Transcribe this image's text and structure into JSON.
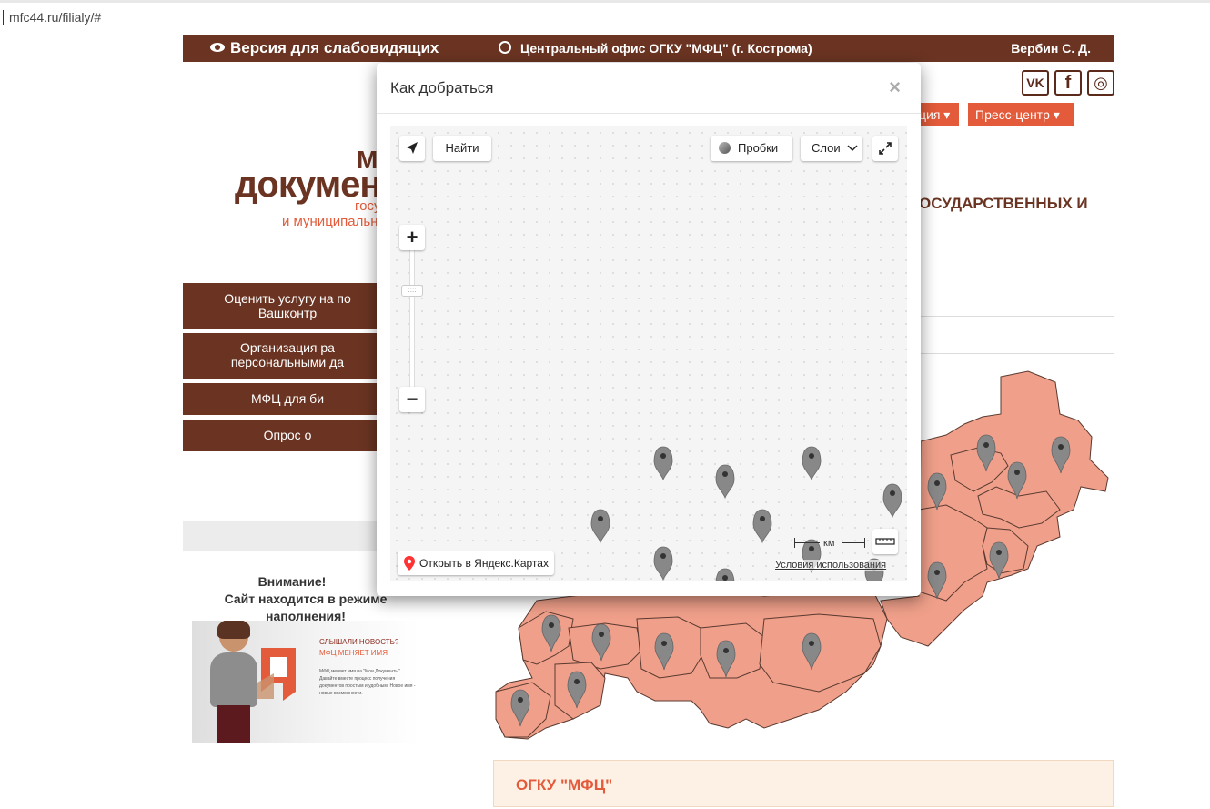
{
  "browser": {
    "url": "mfc44.ru/filialy/#"
  },
  "topbar": {
    "accessibility_label": "Версия для слабовидящих",
    "office_label": "Центральный офис ОГКУ \"МФЦ\" (г. Кострома)",
    "user_label": "Вербин С. Д."
  },
  "social": {
    "vk": "VK",
    "fb": "f",
    "ig": "◎"
  },
  "nav": {
    "item1": "ция ▾",
    "item2": "Пресс-центр ▾"
  },
  "logo": {
    "line0": "М",
    "line1": "докумен",
    "line2": "государ",
    "line3": "и муниципальн"
  },
  "headline": "ОСУДАРСТВЕННЫХ И",
  "sidebar": {
    "btn1_line1": "Оценить услугу на по",
    "btn1_line2": "Вашконтр",
    "btn2_line1": "Организация ра",
    "btn2_line2": "персональными да",
    "btn3": "МФЦ для би",
    "btn4": "Опрос о"
  },
  "notice": {
    "line1": "Внимание!",
    "line2": "Сайт находится в режиме наполнения!"
  },
  "banner": {
    "title_line1": "СЛЫШАЛИ НОВОСТЬ?",
    "title_line2": "МФЦ МЕНЯЕТ ИМЯ",
    "text": "МФЦ меняет имя на \"Мои Документы\". Давайте вместе процесс получения документов простым и удобным! Новое имя - новые возможности."
  },
  "footer": {
    "title": "ОГКУ \"МФЦ\""
  },
  "colors": {
    "brand_brown": "#6b3422",
    "accent_orange": "#e35b3a",
    "region_fill": "#f0a08a"
  },
  "modal": {
    "title": "Как добраться",
    "close": "×",
    "map": {
      "find_button": "Найти",
      "traffic_button": "Пробки",
      "layers_button": "Слои",
      "zoom_in": "+",
      "zoom_out": "−",
      "open_in_yandex": "Открыть в Яндекс.Картах",
      "scale_unit": "км",
      "terms": "Условия использования"
    }
  }
}
